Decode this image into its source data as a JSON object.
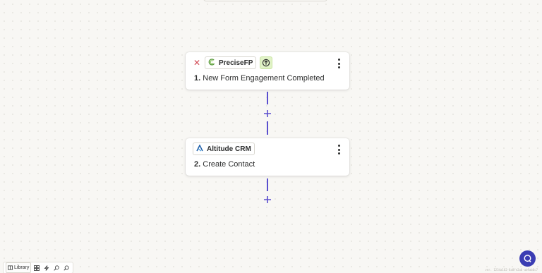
{
  "steps": [
    {
      "app_name": "PreciseFP",
      "number": "1.",
      "title": "New Form Engagement Completed",
      "icons": [
        "close-icon",
        "precisefp-logo-icon",
        "trigger-icon",
        "more-options-icon"
      ]
    },
    {
      "app_name": "Altitude CRM",
      "number": "2.",
      "title": "Create Contact",
      "icons": [
        "altitude-crm-logo-icon",
        "more-options-icon"
      ]
    }
  ],
  "toolbar": {
    "library_label": "Library",
    "icons": [
      "library-icon",
      "apps-grid-icon",
      "lightning-icon",
      "zoom-icon",
      "search-icon"
    ]
  },
  "version_text": "ver. 1234a162-8a8fe2a6-ab9ab6c7",
  "colors": {
    "accent": "#5a4fcf",
    "close": "#d24b55",
    "chat": "#3b3db3",
    "trigger_badge": "#e1f3c7",
    "background": "#f8f7f4"
  }
}
